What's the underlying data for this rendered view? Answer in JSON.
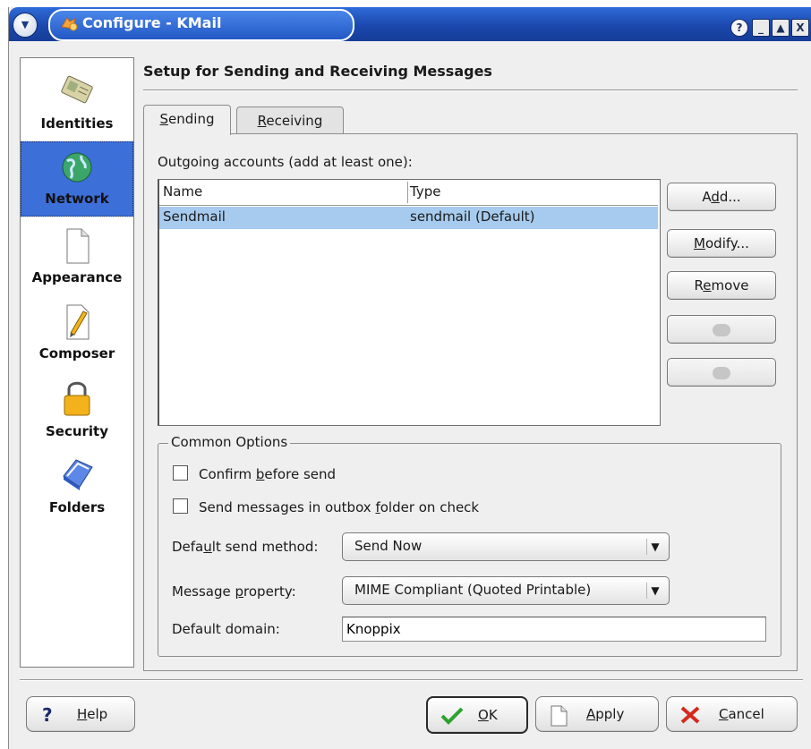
{
  "window": {
    "title": "Configure - KMail",
    "controls": {
      "help": "?",
      "minimize": "_",
      "maximize": "▲",
      "close": "X"
    }
  },
  "sidebar": {
    "items": [
      {
        "label": "Identities",
        "icon": "identities-card-icon",
        "selected": false
      },
      {
        "label": "Network",
        "icon": "globe-icon",
        "selected": true
      },
      {
        "label": "Appearance",
        "icon": "document-icon",
        "selected": false
      },
      {
        "label": "Composer",
        "icon": "pencil-icon",
        "selected": false
      },
      {
        "label": "Security",
        "icon": "padlock-icon",
        "selected": false
      },
      {
        "label": "Folders",
        "icon": "folder-icon",
        "selected": false
      }
    ]
  },
  "page": {
    "title": "Setup for Sending and Receiving Messages"
  },
  "tabs": [
    {
      "label": "Sending",
      "mnemonic": "S",
      "rest": "ending",
      "active": true
    },
    {
      "label": "Receiving",
      "mnemonic": "R",
      "rest": "eceiving",
      "active": false
    }
  ],
  "sending": {
    "accounts_label": "Outgoing accounts (add at least one):",
    "columns": [
      "Name",
      "Type"
    ],
    "rows": [
      {
        "name": "Sendmail",
        "type": "sendmail (Default)",
        "selected": true
      }
    ],
    "buttons": {
      "add": {
        "pre": "A",
        "mn": "d",
        "post": "d..."
      },
      "modify": {
        "pre": "",
        "mn": "M",
        "post": "odify..."
      },
      "remove": {
        "pre": "R",
        "mn": "e",
        "post": "move"
      }
    },
    "common_options": {
      "title": "Common Options",
      "confirm": {
        "pre": "Confirm ",
        "mn": "b",
        "post": "efore send",
        "checked": false
      },
      "outbox": {
        "pre": "Send messages in outbox ",
        "mn": "f",
        "post": "older on check",
        "checked": false
      },
      "send_method": {
        "pre": "Defa",
        "mn": "u",
        "post": "lt send method:",
        "value": "Send Now"
      },
      "message_property": {
        "pre": "Message ",
        "mn": "p",
        "post": "roperty:",
        "value": "MIME Compliant (Quoted Printable)"
      },
      "default_domain": {
        "label": "Default domain:",
        "value": "Knoppix"
      }
    }
  },
  "footer": {
    "help": {
      "mn": "H",
      "post": "elp"
    },
    "ok": {
      "mn": "O",
      "post": "K"
    },
    "apply": {
      "mn": "A",
      "post": "pply"
    },
    "cancel": {
      "mn": "C",
      "post": "ancel"
    }
  },
  "colors": {
    "titlebar": "#1b48ad",
    "selection": "#3d6fd9",
    "row_highlight": "#a7cbee",
    "background": "#efefef"
  }
}
